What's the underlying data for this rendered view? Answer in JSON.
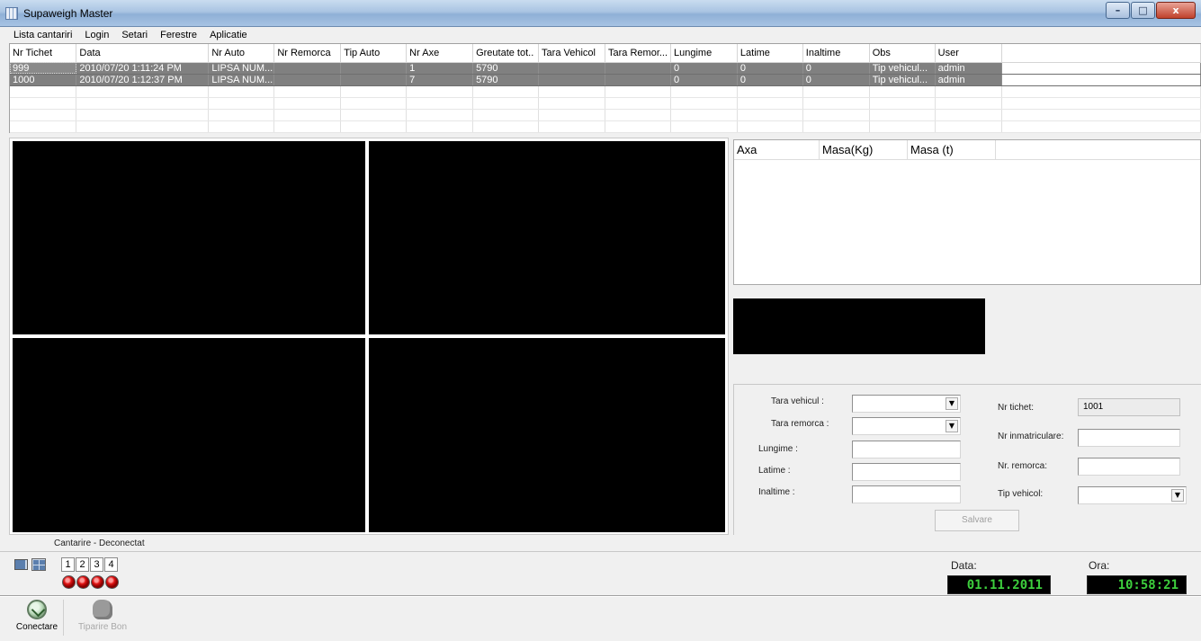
{
  "window": {
    "title": "Supaweigh Master",
    "minimize": "–",
    "maximize": "□",
    "close": "x"
  },
  "menu": [
    "Lista cantariri",
    "Login",
    "Setari",
    "Ferestre",
    "Aplicatie"
  ],
  "grid": {
    "columns": [
      "Nr Tichet",
      "Data",
      "Nr Auto",
      "Nr Remorca",
      "Tip Auto",
      "Nr Axe",
      "Greutate tot..",
      "Tara Vehicol",
      "Tara Remor...",
      "Lungime",
      "Latime",
      "Inaltime",
      "Obs",
      "User"
    ],
    "rows": [
      [
        "999",
        "2010/07/20 1:11:24 PM",
        "LIPSA NUM...",
        "",
        "",
        "1",
        "5790",
        "",
        "",
        "0",
        "0",
        "0",
        "Tip vehicul...",
        "admin"
      ],
      [
        "1000",
        "2010/07/20 1:12:37 PM",
        "LIPSA NUM...",
        "",
        "",
        "7",
        "5790",
        "",
        "",
        "0",
        "0",
        "0",
        "Tip vehicul...",
        "admin"
      ]
    ]
  },
  "axles": {
    "columns": [
      "Axa",
      "Masa(Kg)",
      "Masa (t)"
    ]
  },
  "form": {
    "tara_vehicul_label": "Tara vehicul :",
    "tara_remorca_label": "Tara remorca :",
    "lungime_label": "Lungime :",
    "latime_label": "Latime :",
    "inaltime_label": "Inaltime :",
    "nr_tichet_label": "Nr tichet:",
    "nr_tichet_value": "1001",
    "nr_inmatriculare_label": "Nr inmatriculare:",
    "nr_remorca_label": "Nr. remorca:",
    "tip_vehicul_label": "Tip vehicol:",
    "save_label": "Salvare"
  },
  "status": {
    "connection": "Cantarire - Deconectat"
  },
  "cameras": {
    "numbers": [
      "1",
      "2",
      "3",
      "4"
    ]
  },
  "clock": {
    "date_label": "Data:",
    "date_value": "01.11.2011",
    "time_label": "Ora:",
    "time_value": "10:58:21"
  },
  "toolbar": {
    "connect_label": "Conectare",
    "print_label": "Tiparire Bon"
  },
  "colors": {
    "led_red": "#e01414",
    "clock_green": "#3dcf3d",
    "selected_row": "#808080"
  }
}
